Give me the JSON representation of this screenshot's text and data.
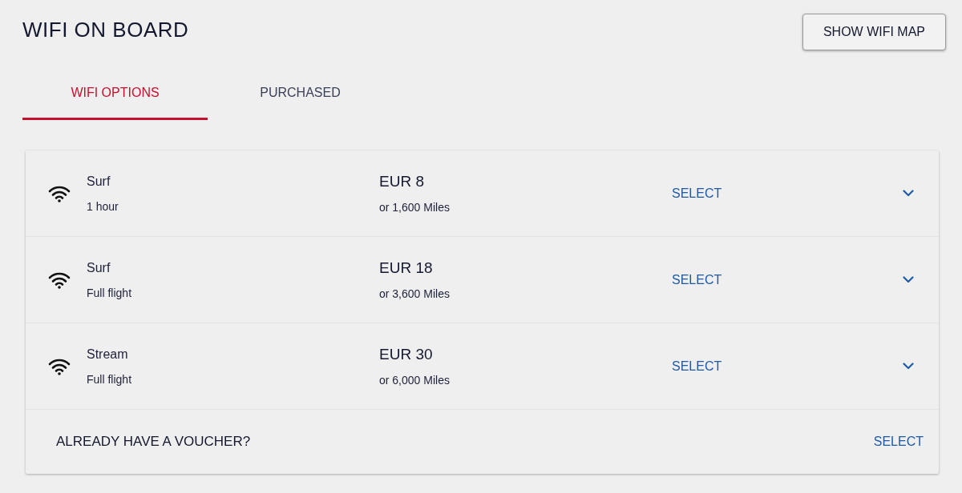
{
  "header": {
    "title": "WIFI ON BOARD",
    "map_button": "SHOW WIFI MAP"
  },
  "tabs": [
    {
      "label": "WIFI OPTIONS",
      "selected": true
    },
    {
      "label": "PURCHASED",
      "selected": false
    }
  ],
  "options": [
    {
      "name": "Surf",
      "duration": "1 hour",
      "price": "EUR 8",
      "miles": "or 1,600 Miles",
      "action": "SELECT",
      "expanded": false
    },
    {
      "name": "Surf",
      "duration": "Full flight",
      "price": "EUR 18",
      "miles": "or 3,600 Miles",
      "action": "SELECT",
      "expanded": false
    },
    {
      "name": "Stream",
      "duration": "Full flight",
      "price": "EUR 30",
      "miles": "or 6,000 Miles",
      "action": "SELECT",
      "expanded": false
    }
  ],
  "voucher": {
    "label": "ALREADY HAVE A VOUCHER?",
    "action": "SELECT"
  }
}
